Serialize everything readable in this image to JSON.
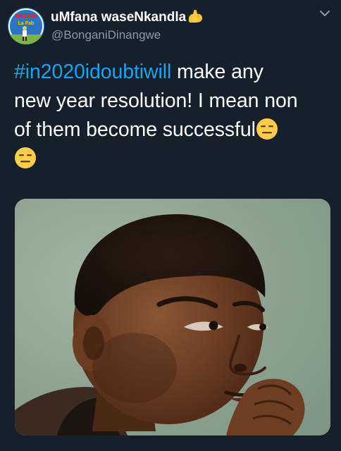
{
  "user": {
    "display_name": "uMfana waseNkandla",
    "name_emoji": "flexed-biceps-emoji",
    "handle": "@BonganiDinangwe",
    "avatar_icon": "avatar-image",
    "avatar_text_top": "MADRID",
    "avatar_text_bottom": "La Fab"
  },
  "header": {
    "menu_icon": "chevron-down-icon"
  },
  "tweet": {
    "hashtag": "#in2020idoubtiwill",
    "line1_rest": " make any",
    "line2": "new year resolution! I mean non",
    "line3": "of them become successful",
    "emoji": "expressionless-face-emoji"
  },
  "media": {
    "image_icon": "photo-boy-thinking-meme",
    "background_color": "#8fa395"
  },
  "colors": {
    "background": "#15202b",
    "link": "#1da1f2",
    "secondary_text": "#8899a6"
  }
}
